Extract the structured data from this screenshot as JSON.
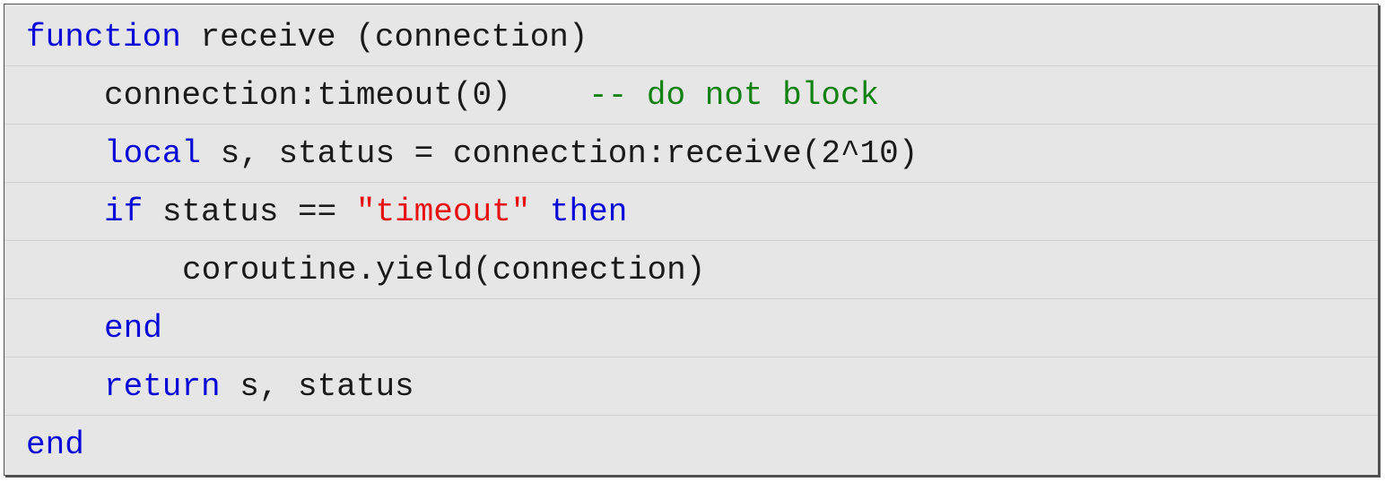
{
  "code": {
    "language": "lua",
    "colors": {
      "background": "#e6e6e6",
      "keyword": "#0a0ad8",
      "string": "#e81010",
      "comment": "#128212",
      "plain": "#1a1a1a"
    },
    "lines": [
      {
        "indent": 0,
        "tokens": [
          {
            "type": "keyword",
            "text": "function"
          },
          {
            "type": "plain",
            "text": " receive (connection)"
          }
        ]
      },
      {
        "indent": 1,
        "tokens": [
          {
            "type": "plain",
            "text": "connection:timeout(0)    "
          },
          {
            "type": "comment",
            "text": "-- do not block"
          }
        ]
      },
      {
        "indent": 1,
        "tokens": [
          {
            "type": "keyword",
            "text": "local"
          },
          {
            "type": "plain",
            "text": " s, status = connection:receive(2^10)"
          }
        ]
      },
      {
        "indent": 1,
        "tokens": [
          {
            "type": "keyword",
            "text": "if"
          },
          {
            "type": "plain",
            "text": " status == "
          },
          {
            "type": "string",
            "text": "\"timeout\""
          },
          {
            "type": "plain",
            "text": " "
          },
          {
            "type": "keyword",
            "text": "then"
          }
        ]
      },
      {
        "indent": 2,
        "tokens": [
          {
            "type": "plain",
            "text": "coroutine.yield(connection)"
          }
        ]
      },
      {
        "indent": 1,
        "tokens": [
          {
            "type": "keyword",
            "text": "end"
          }
        ]
      },
      {
        "indent": 1,
        "tokens": [
          {
            "type": "keyword",
            "text": "return"
          },
          {
            "type": "plain",
            "text": " s, status"
          }
        ]
      },
      {
        "indent": 0,
        "tokens": [
          {
            "type": "keyword",
            "text": "end"
          }
        ]
      }
    ]
  }
}
